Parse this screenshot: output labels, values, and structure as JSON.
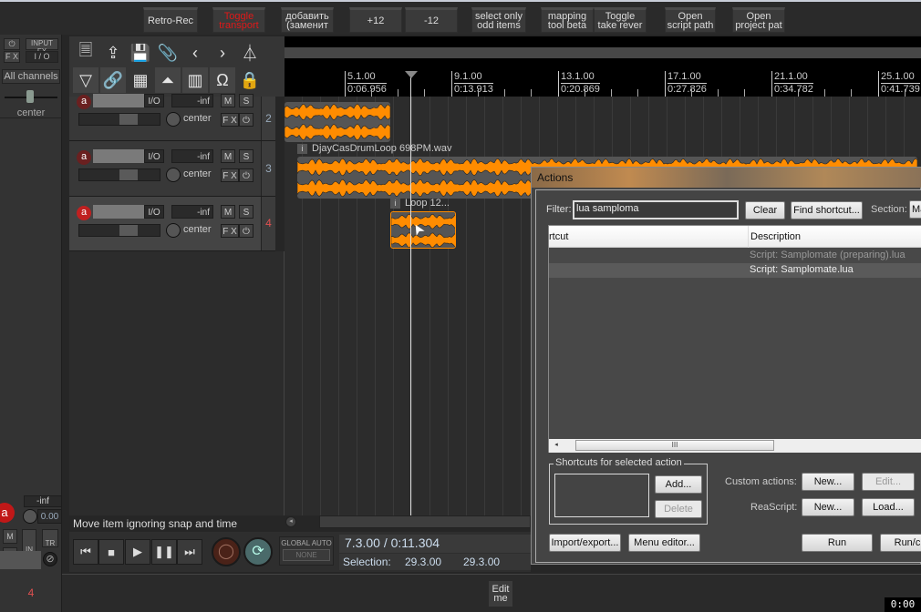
{
  "toolbar": {
    "buttons": [
      {
        "label": "Retro-Rec",
        "color": "#dddddd"
      },
      {
        "label": "Toggle transport",
        "color": "#e01818"
      },
      {
        "label": "добавить (заменит",
        "color": "#dddddd"
      },
      {
        "label": "+12",
        "color": "#dddddd"
      },
      {
        "label": "-12",
        "color": "#dddddd"
      },
      {
        "label": "select only odd items",
        "color": "#dddddd"
      },
      {
        "label": "mapping tool beta",
        "color": "#dddddd"
      },
      {
        "label": "Toggle take rever",
        "color": "#dddddd"
      },
      {
        "label": "Open script path",
        "color": "#dddddd"
      },
      {
        "label": "Open project pat",
        "color": "#dddddd"
      }
    ]
  },
  "mixer": {
    "fx": "F X",
    "input_fx": "INPUT FX",
    "io": "I / O",
    "channels": "All channels",
    "pan": "center",
    "volume": "-inf",
    "vol_value": "0.00",
    "mute": "M",
    "solo": "S",
    "in": "IN",
    "tr": "TR",
    "track_number": "4"
  },
  "icons": [
    "new-project",
    "open-project",
    "save-project",
    "attach",
    "undo-back",
    "redo-forward",
    "metronome",
    "ripple-edit",
    "link",
    "grid",
    "envelope",
    "markers",
    "snap-magnet",
    "lock"
  ],
  "ruler": {
    "marks": [
      {
        "bar": "5.1.00",
        "time": "0:06.956"
      },
      {
        "bar": "9.1.00",
        "time": "0:13.913"
      },
      {
        "bar": "13.1.00",
        "time": "0:20.869"
      },
      {
        "bar": "17.1.00",
        "time": "0:27.826"
      },
      {
        "bar": "21.1.00",
        "time": "0:34.782"
      },
      {
        "bar": "25.1.00",
        "time": "0:41.739"
      }
    ]
  },
  "tracks": [
    {
      "number": "2",
      "volume": "-inf",
      "pan": "center",
      "io": "I/O",
      "mute": "M",
      "solo": "S",
      "fx": "F X",
      "selected": false
    },
    {
      "number": "3",
      "volume": "-inf",
      "pan": "center",
      "io": "I/O",
      "mute": "M",
      "solo": "S",
      "fx": "F X",
      "selected": false
    },
    {
      "number": "4",
      "volume": "-inf",
      "pan": "center",
      "io": "I/O",
      "mute": "M",
      "solo": "S",
      "fx": "F X",
      "selected": true
    }
  ],
  "items": [
    {
      "name": ""
    },
    {
      "name": "DjayCasDrumLoop 698PM.wav"
    },
    {
      "name": "Loop 12..."
    }
  ],
  "status": "Move item ignoring snap and time selection",
  "transport": {
    "global_auto": "GLOBAL AUTO",
    "auto_mode": "NONE",
    "position": "7.3.00 / 0:11.304",
    "selection_label": "Selection:",
    "sel_start": "29.3.00",
    "sel_end": "29.3.00"
  },
  "docker": {
    "edit_me": "Edit me"
  },
  "actions": {
    "title": "Actions",
    "filter_label": "Filter:",
    "filter_value": "lua samploma",
    "clear": "Clear",
    "find_shortcut": "Find shortcut...",
    "section_label": "Section:",
    "section_value": "Ma",
    "col_shortcut": "rtcut",
    "col_description": "Description",
    "rows": [
      {
        "description": "Script: Samplomate (preparing).lua",
        "selected": false
      },
      {
        "description": "Script: Samplomate.lua",
        "selected": true
      }
    ],
    "shortcuts_group": "Shortcuts for selected action",
    "add": "Add...",
    "delete": "Delete",
    "custom_label": "Custom actions:",
    "custom_new": "New...",
    "custom_edit": "Edit...",
    "reascript_label": "ReaScript:",
    "rs_new": "New...",
    "rs_load": "Load...",
    "import_export": "Import/export...",
    "menu_editor": "Menu editor...",
    "run": "Run",
    "run_close": "Run/c",
    "scroll_grip": "III"
  },
  "clock": "0:00",
  "colors": {
    "waveform": "#ff8c00",
    "accent_red": "#e01818"
  }
}
